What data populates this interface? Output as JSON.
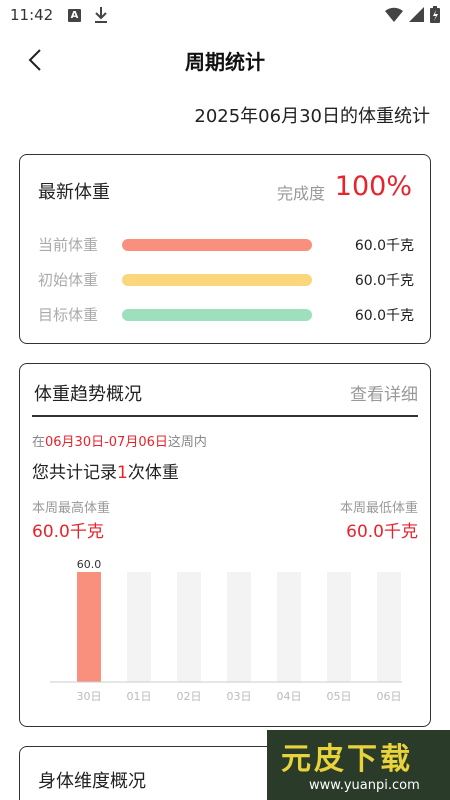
{
  "status_bar": {
    "time": "11:42",
    "notif_letter": "A"
  },
  "header": {
    "title": "周期统计"
  },
  "date_line": "2025年06月30日的体重统计",
  "latest_weight": {
    "title": "最新体重",
    "completion_label": "完成度",
    "completion_value": "100%",
    "rows": [
      {
        "label": "当前体重",
        "value": "60.0千克",
        "color": "#f98f7d",
        "fill": 1.0
      },
      {
        "label": "初始体重",
        "value": "60.0千克",
        "color": "#fad77d",
        "fill": 1.0
      },
      {
        "label": "目标体重",
        "value": "60.0千克",
        "color": "#9edfbe",
        "fill": 1.0
      }
    ]
  },
  "trend": {
    "title": "体重趋势概况",
    "detail_link": "查看详细",
    "range_prefix": "在",
    "range_dates": "06月30日-07月06日",
    "range_suffix": "这周内",
    "count_prefix": "您共计记录",
    "count_value": "1",
    "count_suffix": "次体重",
    "high_label": "本周最高体重",
    "high_value": "60.0千克",
    "low_label": "本周最低体重",
    "low_value": "60.0千克"
  },
  "chart_data": {
    "type": "bar",
    "categories": [
      "30日",
      "01日",
      "02日",
      "03日",
      "04日",
      "05日",
      "06日"
    ],
    "values": [
      60.0,
      null,
      null,
      null,
      null,
      null,
      null
    ],
    "data_labels": [
      "60.0",
      "",
      "",
      "",
      "",
      "",
      ""
    ],
    "bar_color": "#f98f7d",
    "empty_color": "#f3f3f3",
    "ylim": [
      0,
      60
    ],
    "grid": false
  },
  "body_dims": {
    "title": "身体维度概况"
  },
  "watermark": {
    "text": "元皮下载",
    "url": "www.yuanpi.com"
  }
}
